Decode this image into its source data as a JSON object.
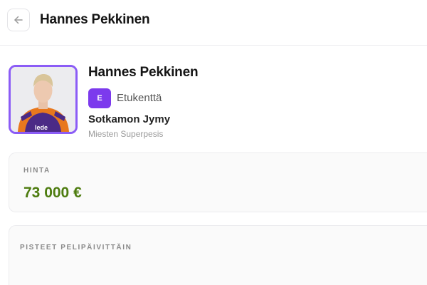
{
  "header": {
    "title": "Hannes Pekkinen",
    "back_icon": "arrow-left-icon"
  },
  "player": {
    "name": "Hannes Pekkinen",
    "position_badge": "E",
    "position_label": "Etukenttä",
    "team": "Sotkamon Jymy",
    "league": "Miesten Superpesis",
    "photo_jersey_text": "lede",
    "accent_color": "#8b5cf6",
    "badge_color": "#7c3aed"
  },
  "price": {
    "label": "HINTA",
    "value": "73 000 €",
    "value_color": "#4d7c0f"
  },
  "points": {
    "label": "PISTEET PELIPÄIVITTÄIN"
  }
}
